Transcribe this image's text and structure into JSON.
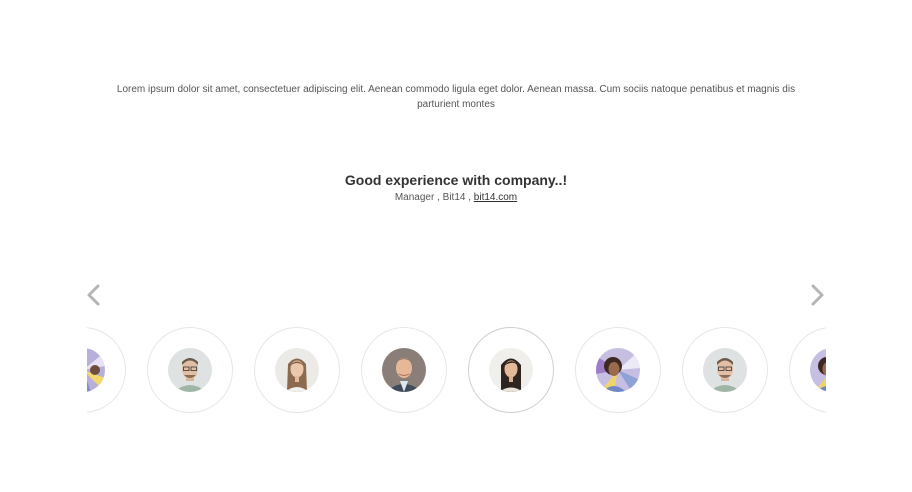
{
  "testimonial": {
    "quote": "Lorem ipsum dolor sit amet, consectetuer adipiscing elit. Aenean commodo ligula eget dolor. Aenean massa. Cum sociis natoque penatibus et magnis dis parturient montes",
    "title": "Good experience with company..!",
    "role_company": "Manager , Bit14 , ",
    "link_text": "bit14.com"
  },
  "carousel": {
    "prev_icon": "chevron-left-icon",
    "next_icon": "chevron-right-icon",
    "arrow_color": "#b5b5b5",
    "thumbnails": [
      {
        "name": "avatar-colorful-background",
        "partial": true
      },
      {
        "name": "avatar-man-with-glasses",
        "partial": false
      },
      {
        "name": "avatar-woman-long-hair",
        "partial": false
      },
      {
        "name": "avatar-man-in-suit",
        "partial": false
      },
      {
        "name": "avatar-woman-dark-hair",
        "partial": false,
        "active": true
      },
      {
        "name": "avatar-woman-colorful-background",
        "partial": false
      },
      {
        "name": "avatar-man-with-glasses",
        "partial": false
      },
      {
        "name": "avatar-woman-colorful-background",
        "partial": true
      }
    ]
  }
}
